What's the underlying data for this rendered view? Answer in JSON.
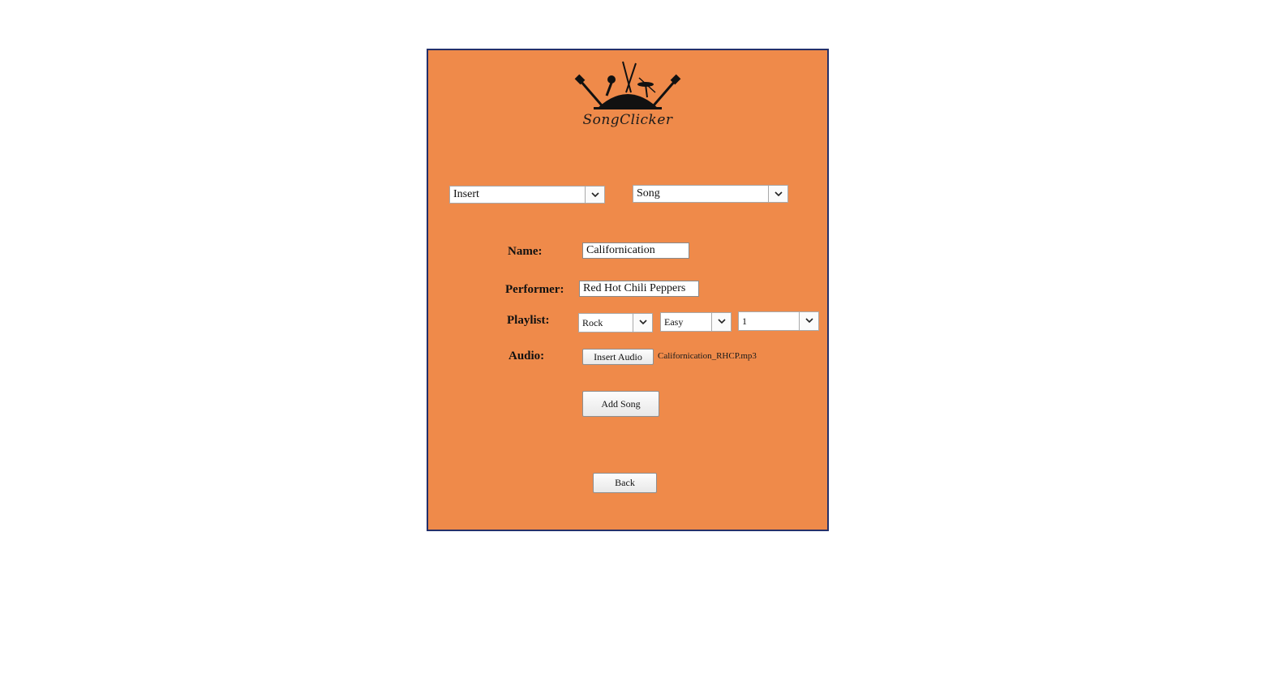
{
  "logo": {
    "icon": "band-instruments-icon",
    "text": "SongClicker"
  },
  "controls": {
    "action_select": "Insert",
    "entity_select": "Song"
  },
  "form": {
    "name_label": "Name:",
    "name_value": "Californication",
    "performer_label": "Performer:",
    "performer_value": "Red Hot Chili Peppers",
    "playlist_label": "Playlist:",
    "playlist_genre": "Rock",
    "playlist_difficulty": "Easy",
    "playlist_number": "1",
    "audio_label": "Audio:",
    "insert_audio_button": "Insert Audio",
    "audio_filename": "Californication_RHCP.mp3",
    "add_song_button": "Add Song"
  },
  "footer": {
    "back_button": "Back"
  },
  "colors": {
    "panel_bg": "#ef8a4a",
    "panel_border": "#24306a"
  }
}
